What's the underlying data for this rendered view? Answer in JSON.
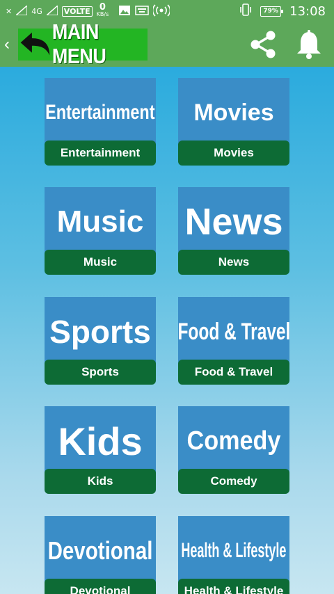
{
  "status_bar": {
    "network": "4G",
    "volte": "VOLTE",
    "speed": "0",
    "speed_unit": "KB/s",
    "battery": "79%",
    "time": "13:08"
  },
  "header": {
    "title": "MAIN MENU",
    "back_icon": "chevron-left-icon",
    "share_icon": "share-icon",
    "bell_icon": "bell-icon"
  },
  "categories": [
    {
      "image_text": "Entertainment",
      "label": "Entertainment"
    },
    {
      "image_text": "Movies",
      "label": "Movies"
    },
    {
      "image_text": "Music",
      "label": "Music"
    },
    {
      "image_text": "News",
      "label": "News"
    },
    {
      "image_text": "Sports",
      "label": "Sports"
    },
    {
      "image_text": "Food & Travel",
      "label": "Food & Travel"
    },
    {
      "image_text": "Kids",
      "label": "Kids"
    },
    {
      "image_text": "Comedy",
      "label": "Comedy"
    },
    {
      "image_text": "Devotional",
      "label": "Devotional"
    },
    {
      "image_text": "Health & Lifestyle",
      "label": "Health & Lifestyle"
    }
  ]
}
